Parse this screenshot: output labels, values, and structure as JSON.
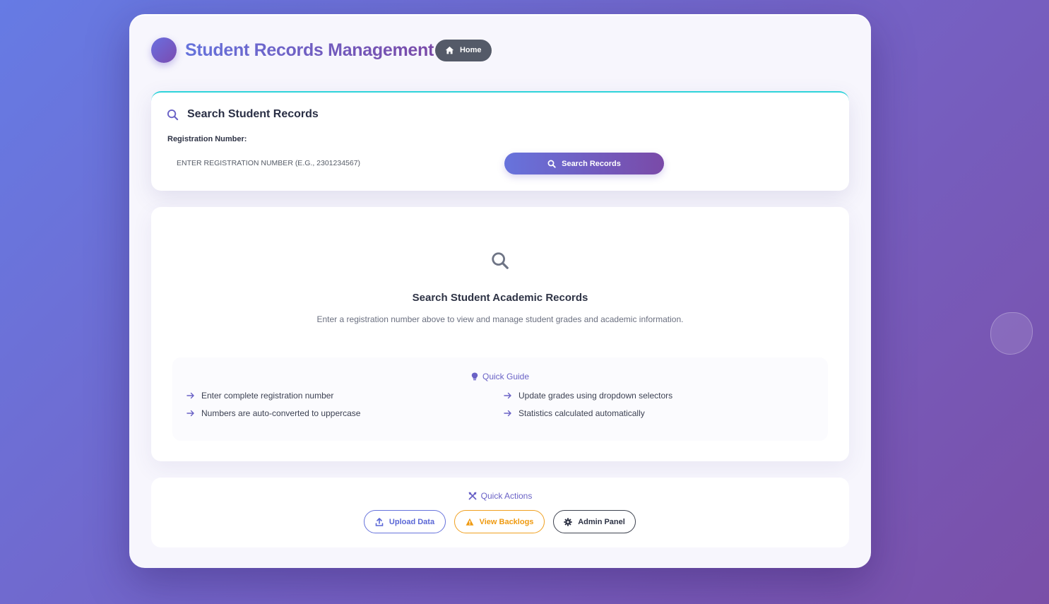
{
  "header": {
    "app_title": "Student Records Management",
    "home_label": "Home"
  },
  "search": {
    "title": "Search Student Records",
    "field_label": "Registration Number:",
    "placeholder": "ENTER REGISTRATION NUMBER (E.G., 2301234567)",
    "value": "",
    "button_label": "Search Records"
  },
  "empty_state": {
    "title": "Search Student Academic Records",
    "subtitle": "Enter a registration number above to view and manage student grades and academic information.",
    "guide": {
      "title": "Quick Guide",
      "items": [
        "Enter complete registration number",
        "Numbers are auto-converted to uppercase",
        "Update grades using dropdown selectors",
        "Statistics calculated automatically"
      ]
    }
  },
  "quick_actions": {
    "title": "Quick Actions",
    "buttons": [
      {
        "label": "Upload Data",
        "icon": "upload-icon"
      },
      {
        "label": "View Backlogs",
        "icon": "warning-icon"
      },
      {
        "label": "Admin Panel",
        "icon": "gear-icon"
      }
    ]
  },
  "colors": {
    "accent_start": "#6773dc",
    "accent_end": "#7a4aa8",
    "panel_top_border": "#2fd3da",
    "warning": "#f0a020",
    "home_button": "#545a68"
  }
}
